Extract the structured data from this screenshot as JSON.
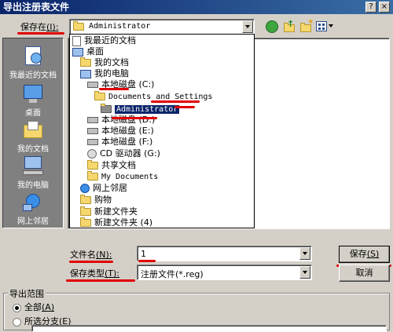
{
  "window": {
    "title": "导出注册表文件",
    "help_glyph": "?",
    "close_glyph": "×"
  },
  "save_in": {
    "label": "保存在",
    "hotkey": "(I):",
    "value": "Administrator"
  },
  "toolbar": {
    "icons": [
      "back-icon",
      "up-folder-icon",
      "new-folder-icon",
      "views-menu-icon"
    ]
  },
  "dropdown_items": [
    {
      "label": "我最近的文档",
      "icon": "recent-docs-icon",
      "indent": 0
    },
    {
      "label": "桌面",
      "icon": "desktop-icon",
      "indent": 0
    },
    {
      "label": "我的文档",
      "icon": "folder-icon",
      "indent": 1
    },
    {
      "label": "我的电脑",
      "icon": "computer-icon",
      "indent": 1
    },
    {
      "label": "本地磁盘 (C:)",
      "icon": "drive-icon",
      "indent": 2
    },
    {
      "label": "Documents and Settings",
      "icon": "folder-icon",
      "indent": 3
    },
    {
      "label": "Administrator",
      "icon": "folder-icon",
      "indent": 4,
      "selected": true
    },
    {
      "label": "本地磁盘 (D:)",
      "icon": "drive-icon",
      "indent": 2
    },
    {
      "label": "本地磁盘 (E:)",
      "icon": "drive-icon",
      "indent": 2
    },
    {
      "label": "本地磁盘 (F:)",
      "icon": "drive-icon",
      "indent": 2
    },
    {
      "label": "CD 驱动器 (G:)",
      "icon": "cd-drive-icon",
      "indent": 2
    },
    {
      "label": "共享文档",
      "icon": "folder-icon",
      "indent": 2
    },
    {
      "label": "My Documents",
      "icon": "folder-icon",
      "indent": 2
    },
    {
      "label": "网上邻居",
      "icon": "network-icon",
      "indent": 1
    },
    {
      "label": "购物",
      "icon": "folder-icon",
      "indent": 1
    },
    {
      "label": "新建文件夹",
      "icon": "folder-icon",
      "indent": 1
    },
    {
      "label": "新建文件夹 (4)",
      "icon": "folder-icon",
      "indent": 1
    }
  ],
  "places": [
    {
      "label": "我最近的文档",
      "icon": "recent-docs-icon"
    },
    {
      "label": "桌面",
      "icon": "desktop-icon"
    },
    {
      "label": "我的文档",
      "icon": "my-documents-icon"
    },
    {
      "label": "我的电脑",
      "icon": "my-computer-icon"
    },
    {
      "label": "网上邻居",
      "icon": "network-places-icon"
    }
  ],
  "filename": {
    "label": "文件名",
    "hotkey": "(N):",
    "value": "1"
  },
  "filetype": {
    "label": "保存类型",
    "hotkey": "(T):",
    "value": "注册文件(*.reg)"
  },
  "buttons": {
    "save": "保存",
    "save_hotkey": "(S)",
    "cancel": "取消"
  },
  "export_range": {
    "label": "导出范围",
    "all": "全部",
    "all_hotkey": "(A)",
    "selected_branch": "所选分支",
    "selected_branch_hotkey": "(E)"
  },
  "colors": {
    "window_bg": "#d4d0c8",
    "titlebar": "#0a246a",
    "selection": "#0a246a",
    "places_bg": "#808080",
    "annotation_red": "#e00000"
  }
}
